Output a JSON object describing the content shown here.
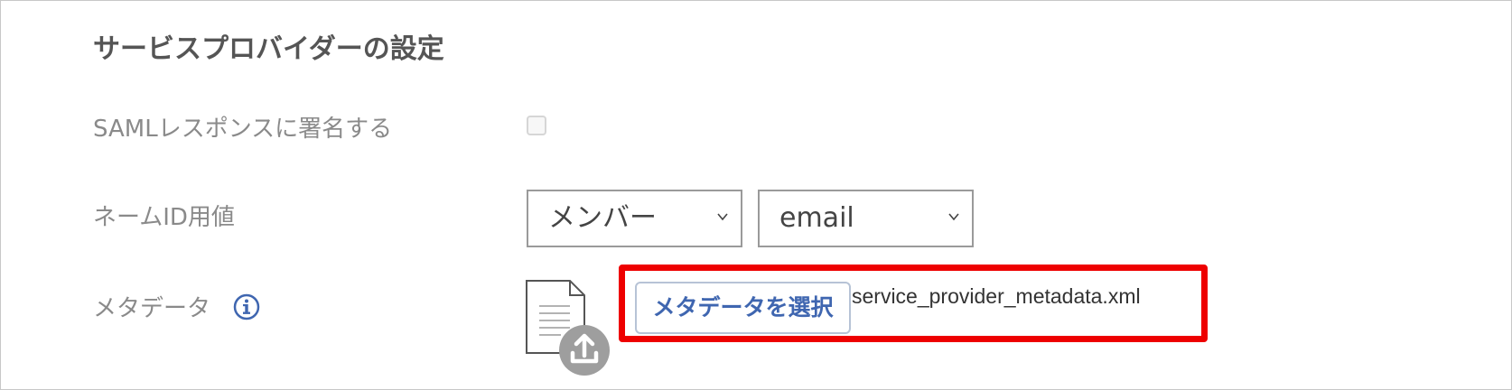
{
  "section": {
    "title": "サービスプロバイダーの設定"
  },
  "fields": {
    "sign_saml": {
      "label": "SAMLレスポンスに署名する",
      "checked": false
    },
    "name_id": {
      "label": "ネームID用値",
      "source_value": "メンバー",
      "attribute_value": "email"
    },
    "metadata": {
      "label": "メタデータ",
      "select_button_label": "メタデータを選択",
      "file_name": "service_provider_metadata.xml"
    }
  },
  "icons": {
    "info": "info-icon",
    "document": "document-icon",
    "upload": "upload-icon",
    "chevron": "chevron-down-icon"
  },
  "colors": {
    "highlight": "#ee0000",
    "accent": "#3f66b0",
    "upload_badge": "#9e9e9e"
  }
}
